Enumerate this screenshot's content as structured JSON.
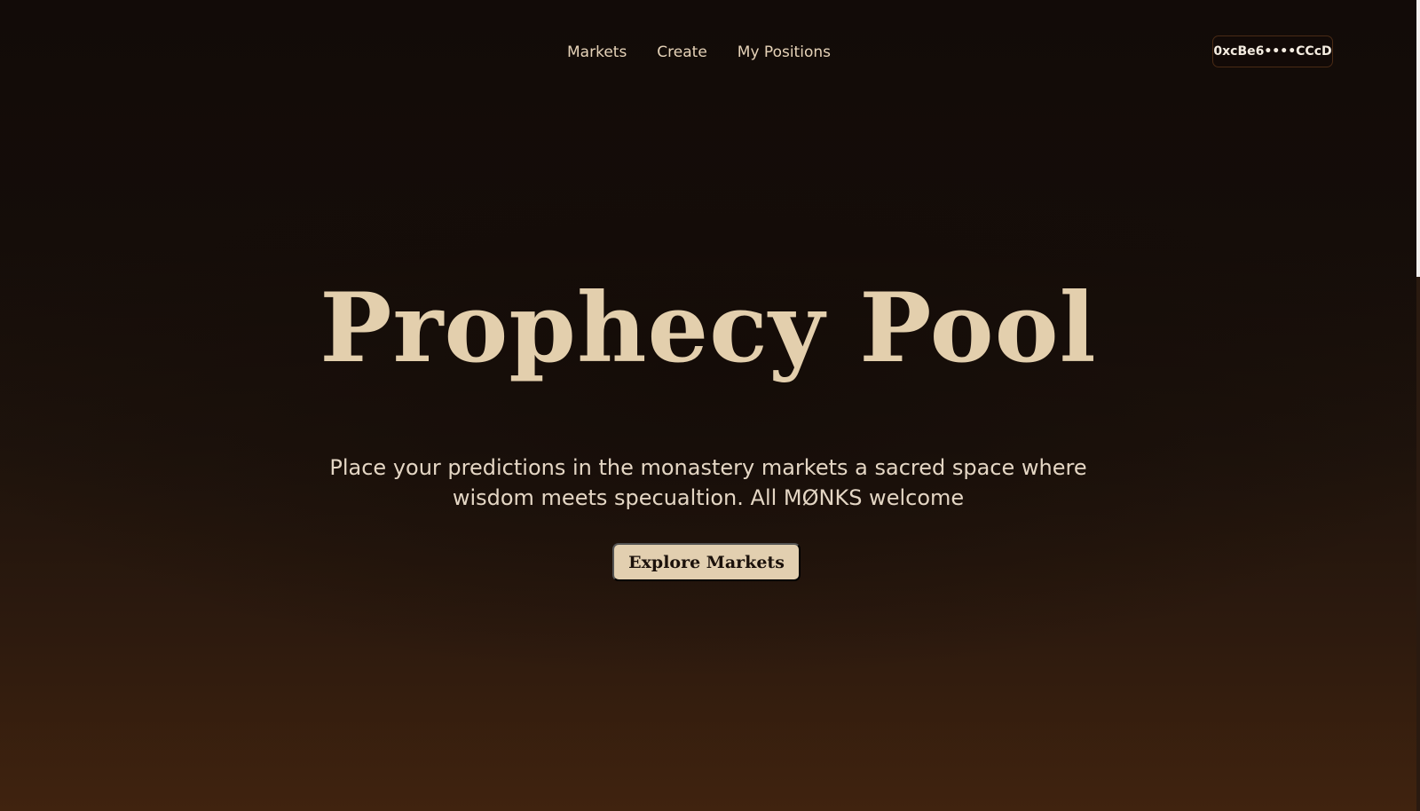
{
  "nav": {
    "links": [
      {
        "label": "Markets"
      },
      {
        "label": "Create"
      },
      {
        "label": "My Positions"
      }
    ],
    "wallet_label": "0xcBe6••••CCcD"
  },
  "hero": {
    "title": "Prophecy Pool",
    "subtitle": "Place your predictions in the monastery markets a sacred space where wisdom meets specualtion. All MØNKS welcome",
    "cta_label": "Explore Markets"
  },
  "colors": {
    "background_top": "#120b08",
    "background_bottom": "#40230f",
    "title": "#e3cfad",
    "button_bg": "#e2cfb0",
    "button_text": "#1b110b"
  }
}
